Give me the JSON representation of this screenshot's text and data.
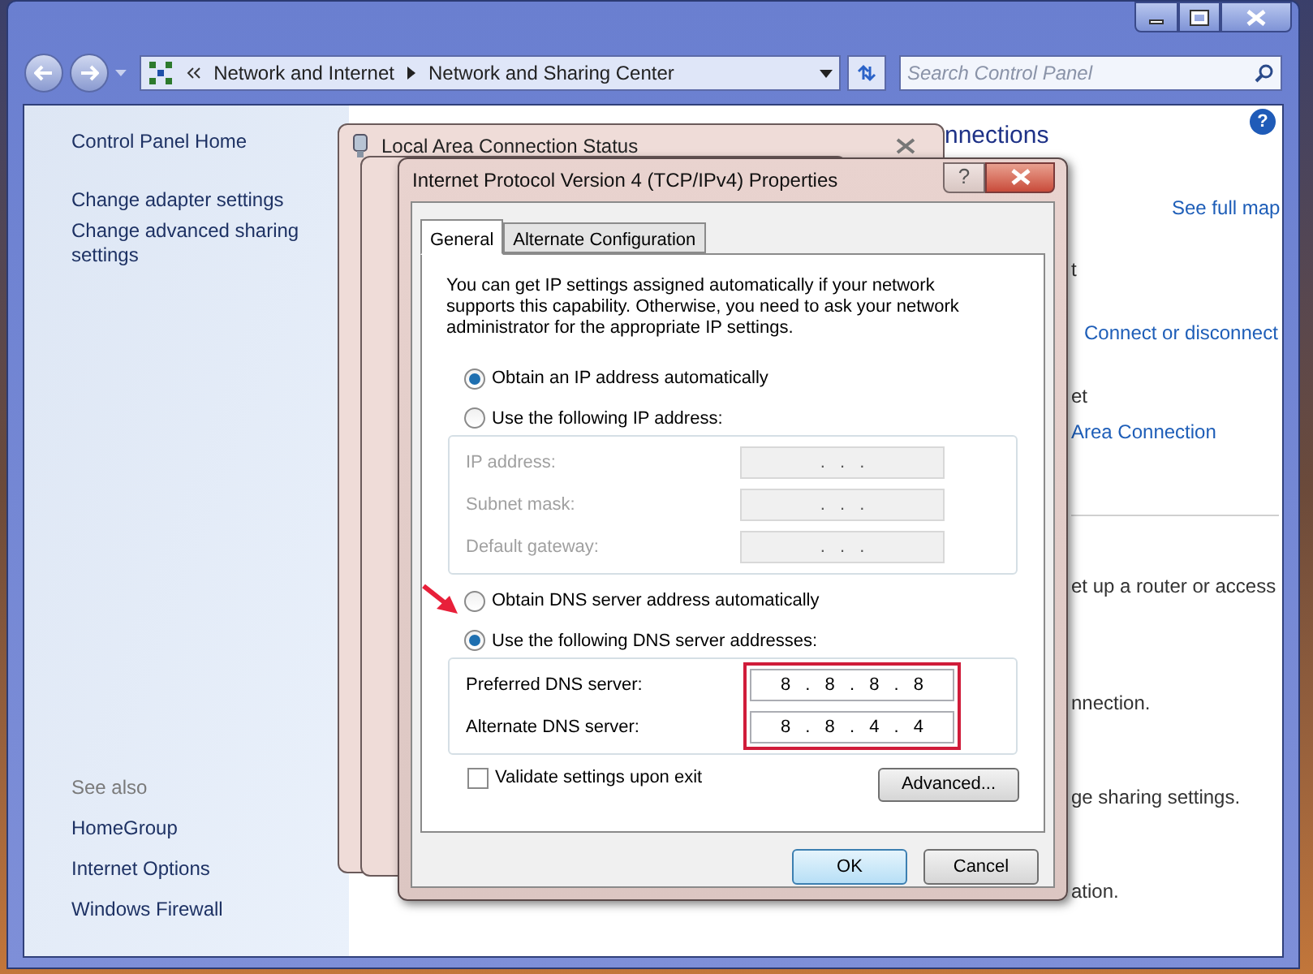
{
  "address_bar": {
    "breadcrumb": [
      "Network and Internet",
      "Network and Sharing Center"
    ],
    "search_placeholder": "Search Control Panel"
  },
  "sidebar": {
    "items": [
      "Control Panel Home",
      "Change adapter settings",
      "Change advanced sharing settings"
    ],
    "see_also_heading": "See also",
    "see_also": [
      "HomeGroup",
      "Internet Options",
      "Windows Firewall"
    ]
  },
  "main": {
    "help_icon": "?",
    "fragments": [
      {
        "kind": "heading",
        "text": "nnections"
      },
      {
        "kind": "link",
        "text": "See full map"
      },
      {
        "kind": "text",
        "text": "t"
      },
      {
        "kind": "link",
        "text": "Connect or disconnect"
      },
      {
        "kind": "text",
        "text": "et"
      },
      {
        "kind": "link",
        "text": "Area Connection"
      },
      {
        "kind": "divider"
      },
      {
        "kind": "text",
        "text": "et up a router or access"
      },
      {
        "kind": "text",
        "text": "nnection."
      },
      {
        "kind": "text",
        "text": "ge sharing settings."
      },
      {
        "kind": "text",
        "text": "ation."
      }
    ]
  },
  "back_dialog": {
    "title": "Local Area Connection Status"
  },
  "dialog": {
    "title": "Internet Protocol Version 4 (TCP/IPv4) Properties",
    "help_button": "?",
    "tabs": [
      {
        "label": "General",
        "selected": true
      },
      {
        "label": "Alternate Configuration",
        "selected": false
      }
    ],
    "intro": "You can get IP settings assigned automatically if your network supports this capability. Otherwise, you need to ask your network administrator for the appropriate IP settings.",
    "ip_options": [
      {
        "label": "Obtain an IP address automatically",
        "selected": true
      },
      {
        "label": "Use the following IP address:",
        "selected": false
      }
    ],
    "ip_fields": {
      "disabled": true,
      "rows": [
        {
          "label": "IP address:",
          "value": ". . ."
        },
        {
          "label": "Subnet mask:",
          "value": ". . ."
        },
        {
          "label": "Default gateway:",
          "value": ". . ."
        }
      ]
    },
    "dns_options": [
      {
        "label": "Obtain DNS server address automatically",
        "selected": false
      },
      {
        "label": "Use the following DNS server addresses:",
        "selected": true
      }
    ],
    "dns_fields": {
      "disabled": false,
      "rows": [
        {
          "label": "Preferred DNS server:",
          "value": "8 . 8 . 8 . 8"
        },
        {
          "label": "Alternate DNS server:",
          "value": "8 . 8 . 4 . 4"
        }
      ]
    },
    "validate": {
      "label": "Validate settings upon exit",
      "checked": false
    },
    "advanced": "Advanced...",
    "buttons": [
      {
        "label": "OK",
        "default": true
      },
      {
        "label": "Cancel",
        "default": false
      }
    ]
  }
}
